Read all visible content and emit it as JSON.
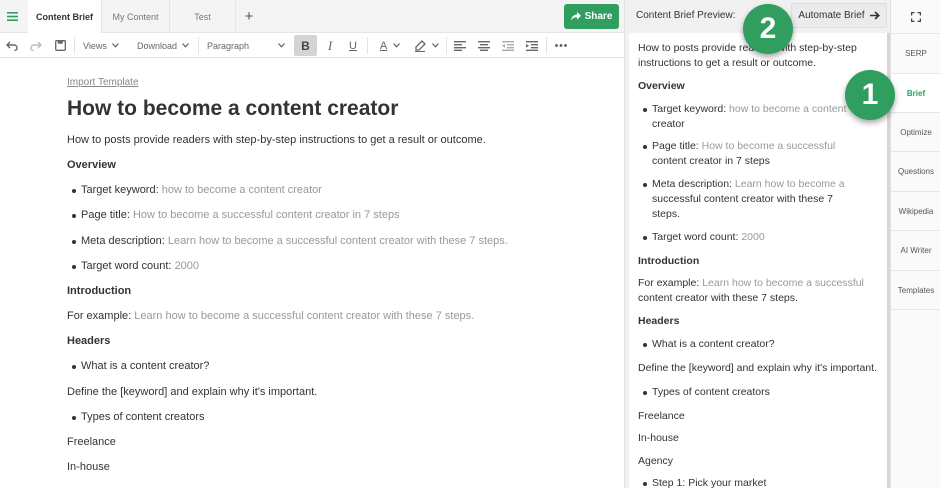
{
  "colors": {
    "accent": "#2f9e5f",
    "muted_text": "#999999"
  },
  "tabs": [
    {
      "label": "Content Brief",
      "active": true
    },
    {
      "label": "My Content",
      "active": false
    },
    {
      "label": "Test",
      "active": false
    }
  ],
  "tab_add_label": "+",
  "share_label": "Share",
  "toolbar": {
    "views_label": "Views",
    "download_label": "Download",
    "paragraph_label": "Paragraph",
    "bold_label": "B",
    "italic_label": "I",
    "underline_label": "U",
    "font_color_label": "A"
  },
  "editor": {
    "import_link": "Import Template",
    "title": "How to become a content creator",
    "intro": "How to posts provide readers with step-by-step instructions to get a result or outcome.",
    "overview_heading": "Overview",
    "overview": [
      {
        "key": "Target keyword:",
        "value": "how to become a content creator"
      },
      {
        "key": "Page title:",
        "value": "How to become a successful content creator in 7 steps"
      },
      {
        "key": "Meta description:",
        "value": "Learn how to become a successful content creator with these 7 steps."
      },
      {
        "key": "Target word count:",
        "value": "2000"
      }
    ],
    "intro_heading": "Introduction",
    "example_key": "For example:",
    "example_value": "Learn how to become a successful content creator with these 7 steps.",
    "headers_heading": "Headers",
    "header1": "What is a content creator?",
    "define_hint": "Define the [keyword] and explain why it's important.",
    "header2": "Types of content creators",
    "freelance": "Freelance",
    "inhouse": "In-house"
  },
  "preview": {
    "title": "Content Brief Preview:",
    "automate_label": "Automate Brief",
    "intro_line1": "How to posts provide readers with step-by-step",
    "intro_line2": "instructions to get a result or outcome.",
    "overview_heading": "Overview",
    "kw_key": "Target keyword:",
    "kw_val1": "how to become a content",
    "kw_val2": "creator",
    "pt_key": "Page title:",
    "pt_val1": "How to become a successful",
    "pt_val2": "content creator in 7 steps",
    "md_key": "Meta description:",
    "md_val1": "Learn how to become a",
    "md_val2": "successful content creator with these 7",
    "md_val3": "steps.",
    "wc_key": "Target word count:",
    "wc_val": "2000",
    "intro_heading": "Introduction",
    "ex_key": "For example:",
    "ex_val1": "Learn how to become a successful",
    "ex_val2": "content creator with these 7 steps.",
    "headers_heading": "Headers",
    "header1": "What is a content creator?",
    "define_hint": "Define the [keyword] and explain why it's important.",
    "header2": "Types of content creators",
    "freelance": "Freelance",
    "inhouse": "In-house",
    "agency": "Agency",
    "step1": "Step 1: Pick your market"
  },
  "sidenav": [
    {
      "label": "SERP",
      "active": false
    },
    {
      "label": "Brief",
      "active": true
    },
    {
      "label": "Optimize",
      "active": false
    },
    {
      "label": "Questions",
      "active": false
    },
    {
      "label": "Wikipedia",
      "active": false
    },
    {
      "label": "AI Writer",
      "active": false
    },
    {
      "label": "Templates",
      "active": false
    }
  ],
  "badges": {
    "one": "1",
    "two": "2"
  }
}
